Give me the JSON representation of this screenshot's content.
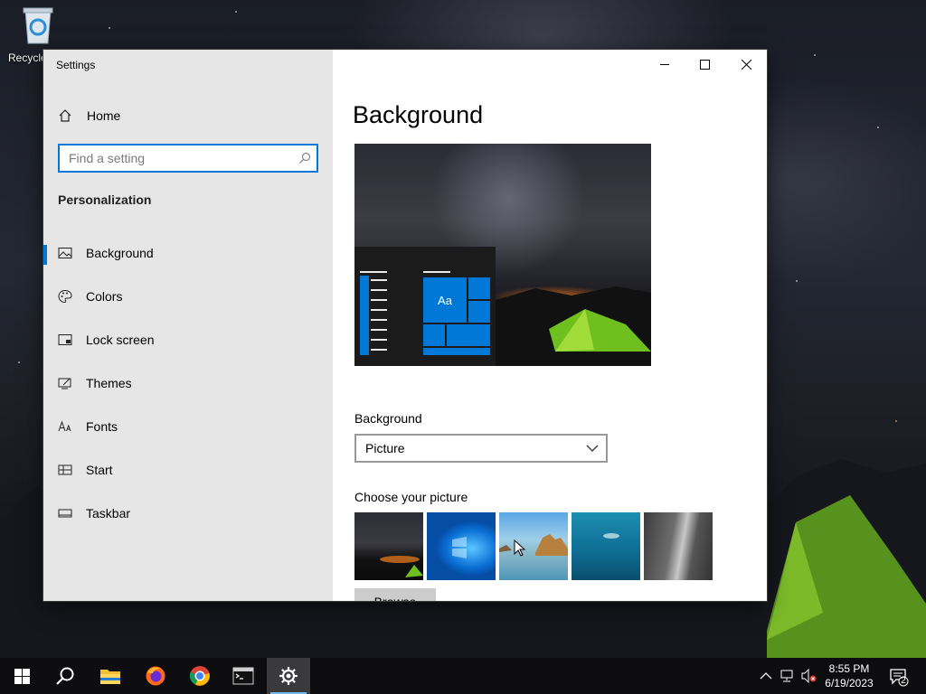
{
  "desktop": {
    "recycle_bin_label": "Recycle"
  },
  "window": {
    "title": "Settings",
    "controls": {
      "minimize": "minimize",
      "maximize": "maximize",
      "close": "close"
    }
  },
  "sidebar": {
    "home_label": "Home",
    "search_placeholder": "Find a setting",
    "section_title": "Personalization",
    "items": [
      {
        "label": "Background",
        "icon": "picture-icon",
        "active": true
      },
      {
        "label": "Colors",
        "icon": "palette-icon",
        "active": false
      },
      {
        "label": "Lock screen",
        "icon": "lock-screen-icon",
        "active": false
      },
      {
        "label": "Themes",
        "icon": "themes-icon",
        "active": false
      },
      {
        "label": "Fonts",
        "icon": "fonts-icon",
        "active": false
      },
      {
        "label": "Start",
        "icon": "start-icon",
        "active": false
      },
      {
        "label": "Taskbar",
        "icon": "taskbar-icon",
        "active": false
      }
    ]
  },
  "main": {
    "title": "Background",
    "preview_tile_text": "Aa",
    "background_label": "Background",
    "background_value": "Picture",
    "choose_label": "Choose your picture",
    "pictures": [
      "night-tent",
      "windows-blue",
      "beach-rocks",
      "underwater-swimmer",
      "rock-cliff"
    ],
    "browse_label": "Browse"
  },
  "taskbar": {
    "apps": [
      "start",
      "search",
      "file-explorer",
      "firefox",
      "chrome",
      "terminal",
      "settings"
    ],
    "time": "8:55 PM",
    "date": "6/19/2023",
    "notification_count": "2"
  },
  "colors": {
    "accent": "#0078d7",
    "sidebar_bg": "#e6e6e6",
    "taskbar_bg": "#0d0d0f"
  }
}
